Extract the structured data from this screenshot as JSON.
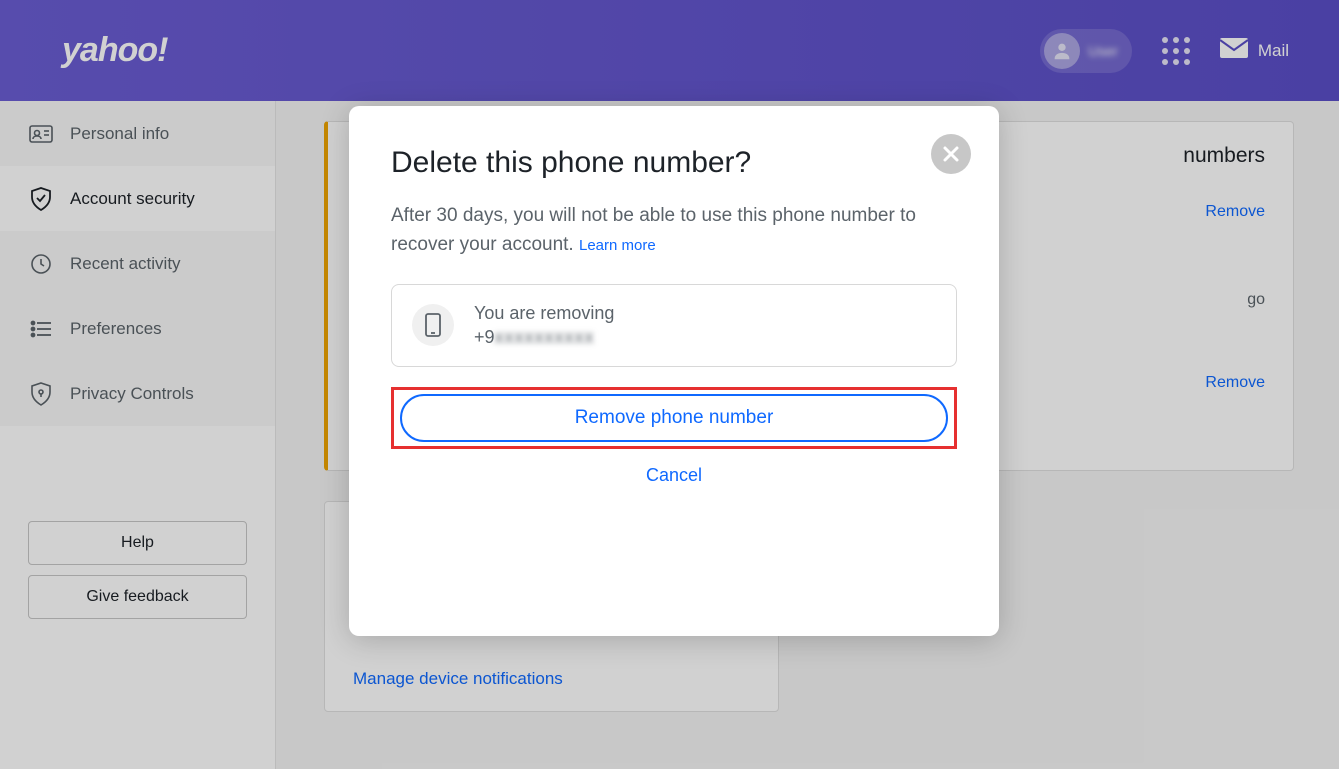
{
  "header": {
    "logo": "yahoo!",
    "user_name": "User",
    "mail_label": "Mail"
  },
  "sidebar": {
    "items": [
      {
        "label": "Personal info"
      },
      {
        "label": "Account security"
      },
      {
        "label": "Recent activity"
      },
      {
        "label": "Preferences"
      },
      {
        "label": "Privacy Controls"
      }
    ],
    "help_label": "Help",
    "feedback_label": "Give feedback"
  },
  "main": {
    "top_card_title_fragment": "numbers",
    "meta_fragment": "go",
    "remove_label": "Remove",
    "manage_link": "Manage device notifications"
  },
  "modal": {
    "title": "Delete this phone number?",
    "description": "After 30 days, you will not be able to use this phone number to recover your account. ",
    "learn_more": "Learn more",
    "removing_label": "You are removing",
    "phone_prefix": "+9",
    "phone_blurred": "xxxxxxxxxx",
    "remove_button": "Remove phone number",
    "cancel_label": "Cancel"
  }
}
